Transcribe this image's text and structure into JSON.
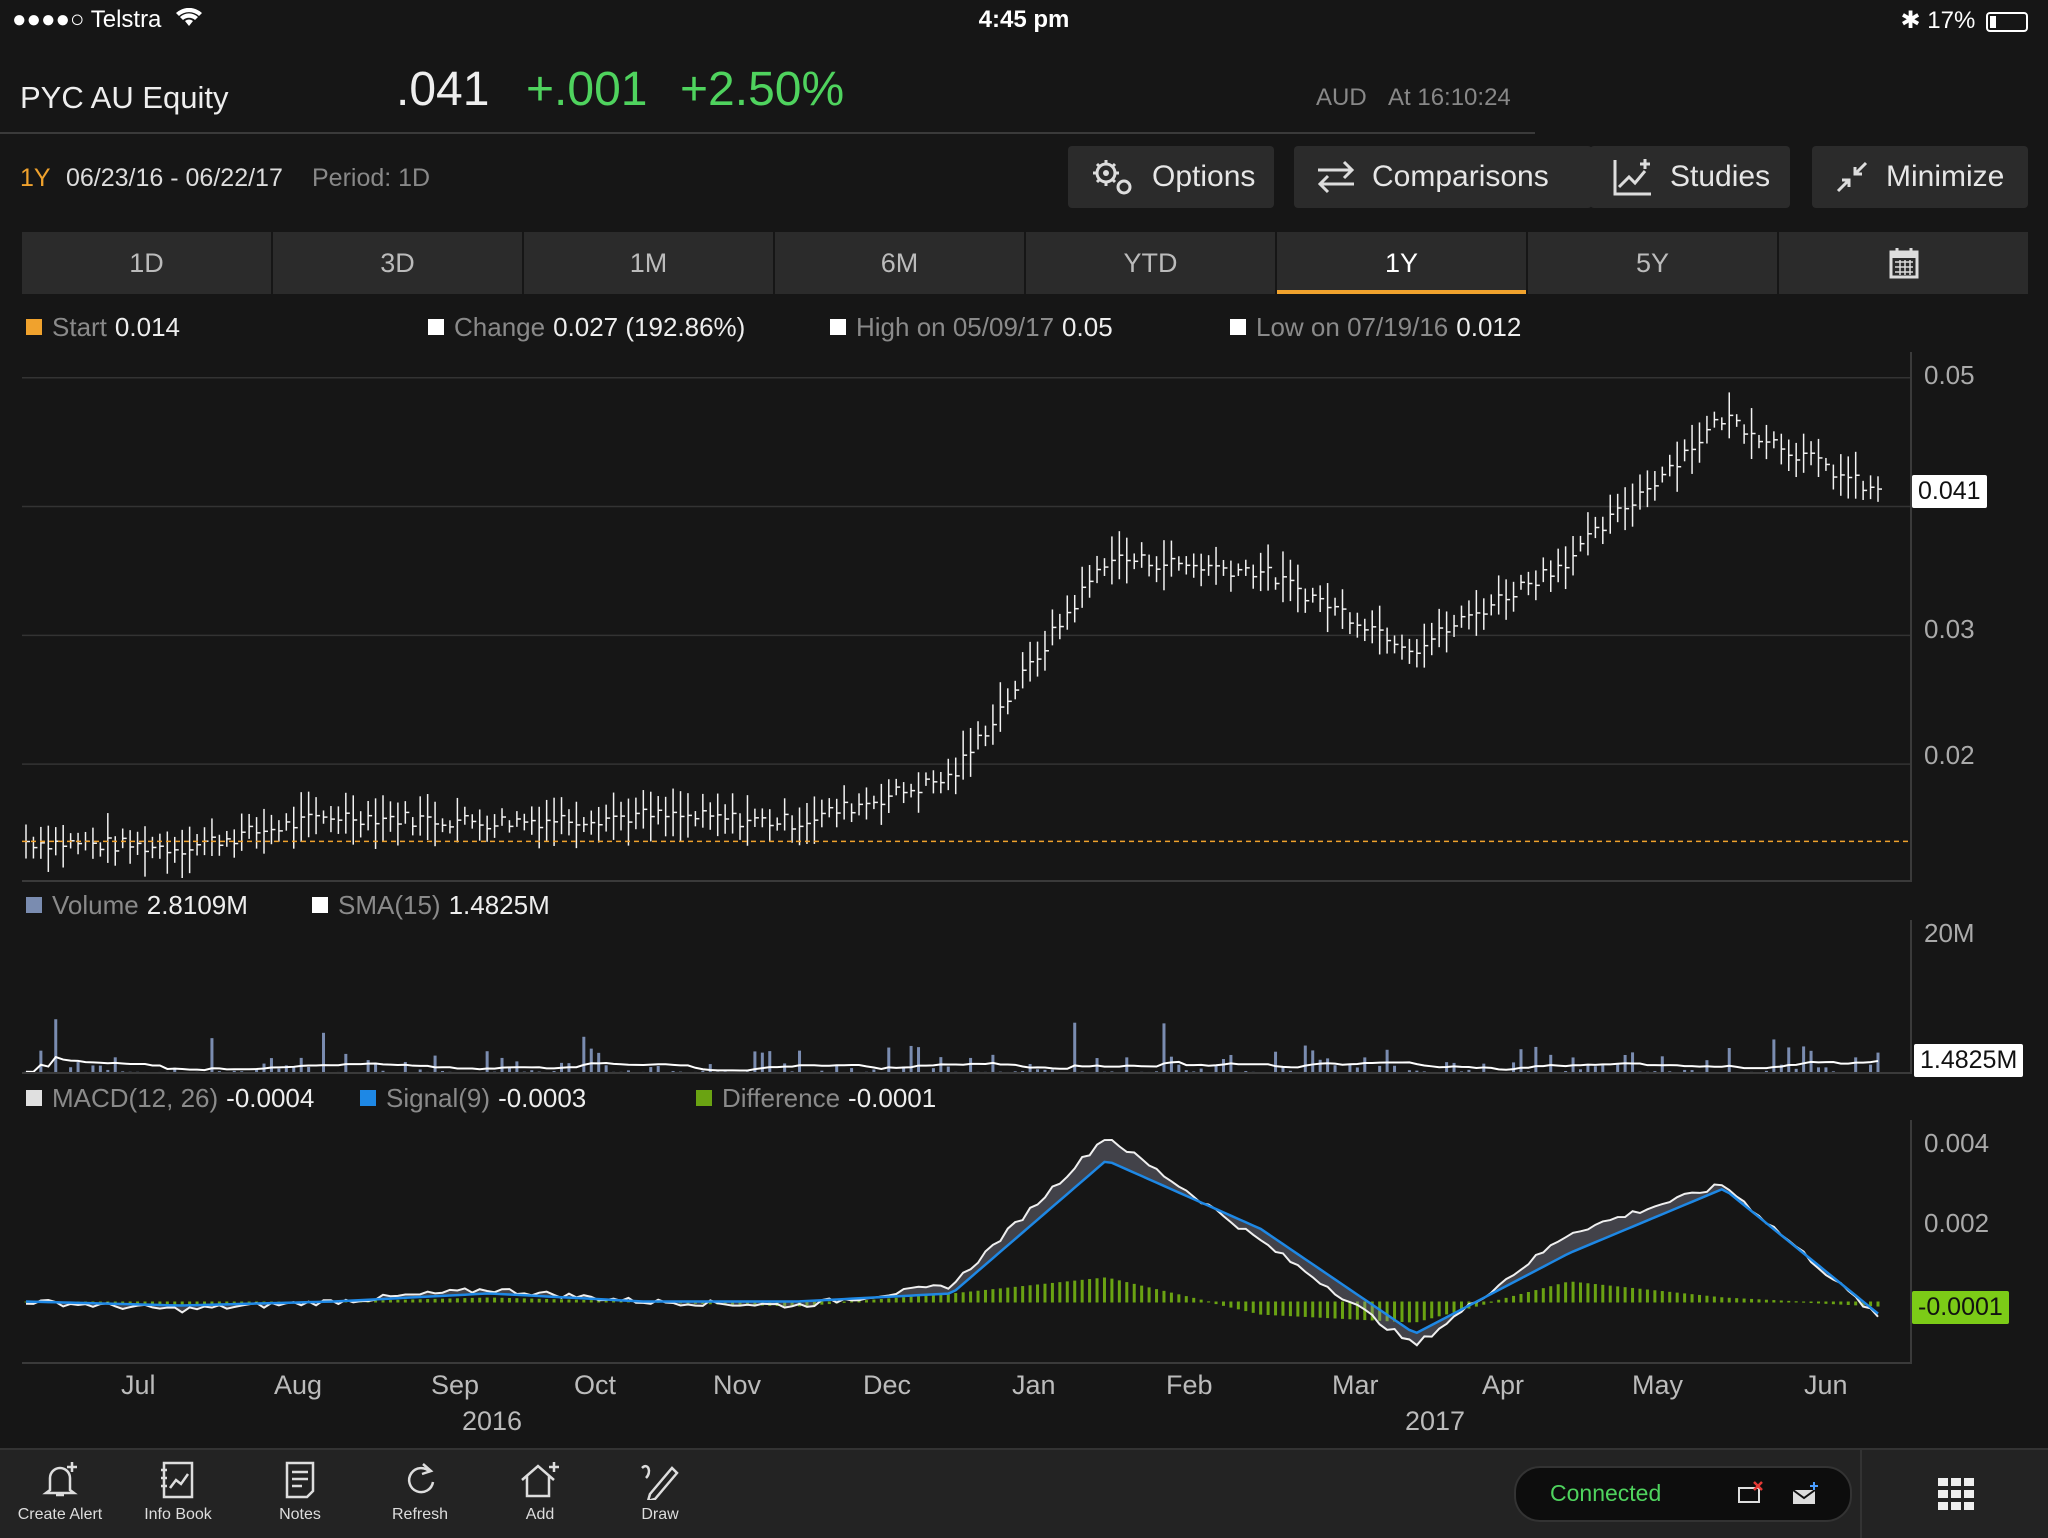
{
  "status_bar": {
    "carrier": "●●●●○ Telstra",
    "time": "4:45 pm",
    "battery": "17%"
  },
  "header": {
    "ticker": "PYC AU Equity",
    "last": ".041",
    "change": "+.001",
    "change_pct": "+2.50%",
    "currency": "AUD",
    "as_of": "At 16:10:24"
  },
  "range": {
    "label": "1Y",
    "dates": "06/23/16 - 06/22/17",
    "period": "Period: 1D"
  },
  "toolbar_buttons": {
    "options": "Options",
    "comparisons": "Comparisons",
    "studies": "Studies",
    "minimize": "Minimize"
  },
  "tabs": [
    "1D",
    "3D",
    "1M",
    "6M",
    "YTD",
    "1Y",
    "5Y"
  ],
  "active_tab": "1Y",
  "price_legend": {
    "start_label": "Start",
    "start_value": "0.014",
    "change_label": "Change",
    "change_value": "0.027 (192.86%)",
    "high_label": "High on 05/09/17",
    "high_value": "0.05",
    "low_label": "Low on 07/19/16",
    "low_value": "0.012"
  },
  "volume_legend": {
    "volume_label": "Volume",
    "volume_value": "2.8109M",
    "sma_label": "SMA(15)",
    "sma_value": "1.4825M"
  },
  "macd_legend": {
    "macd_label": "MACD(12, 26)",
    "macd_value": "-0.0004",
    "signal_label": "Signal(9)",
    "signal_value": "-0.0003",
    "diff_label": "Difference",
    "diff_value": "-0.0001"
  },
  "price_axis": [
    "0.05",
    "0.03",
    "0.02"
  ],
  "price_tag": "0.041",
  "volume_axis": "20M",
  "volume_tag": "1.4825M",
  "macd_axis": [
    "0.004",
    "0.002"
  ],
  "macd_tag": "-0.0001",
  "months": [
    "Jul",
    "Aug",
    "Sep",
    "Oct",
    "Nov",
    "Dec",
    "Jan",
    "Feb",
    "Mar",
    "Apr",
    "May",
    "Jun"
  ],
  "years": [
    "2016",
    "2017"
  ],
  "bottom_tools": [
    "Create Alert",
    "Info Book",
    "Notes",
    "Refresh",
    "Add",
    "Draw"
  ],
  "connection": "Connected",
  "colors": {
    "accent": "#f0a22d",
    "up": "#4fd35e",
    "volume": "#7a8cb0",
    "signal": "#1e88e5",
    "difference": "#6aa312",
    "macd": "#e0e0e0"
  },
  "chart_data": [
    {
      "type": "line",
      "title": "",
      "series": [
        {
          "name": "PYC AU Equity",
          "x": [
            "2016-06",
            "2016-07",
            "2016-08",
            "2016-09",
            "2016-10",
            "2016-11",
            "2016-12",
            "2017-01",
            "2017-02",
            "2017-03",
            "2017-04",
            "2017-05",
            "2017-06"
          ],
          "values": [
            0.014,
            0.0135,
            0.016,
            0.0155,
            0.016,
            0.0155,
            0.019,
            0.036,
            0.035,
            0.029,
            0.036,
            0.047,
            0.041
          ]
        }
      ],
      "ylim": [
        0.011,
        0.052
      ],
      "grid": true
    },
    {
      "type": "bar",
      "series": [
        {
          "name": "Volume",
          "values": [
            2.8109
          ]
        },
        {
          "name": "SMA(15)",
          "values": [
            1.4825
          ]
        }
      ],
      "ylabel": "",
      "ylim": [
        0,
        20
      ]
    },
    {
      "type": "line",
      "series": [
        {
          "name": "MACD(12, 26)",
          "values": [
            0.0,
            -0.0002,
            0.0,
            0.0003,
            0.0,
            -0.0001,
            0.0004,
            0.0041,
            0.0015,
            -0.0011,
            0.0017,
            0.0029,
            -0.0004
          ]
        },
        {
          "name": "Signal(9)",
          "values": [
            0.0,
            -0.0001,
            0.0,
            0.0002,
            0.0,
            0.0,
            0.0002,
            0.0035,
            0.0018,
            -0.0008,
            0.0012,
            0.0028,
            -0.0003
          ]
        },
        {
          "name": "Difference",
          "values": [
            0.0,
            -0.0001,
            0.0,
            0.0001,
            0.0,
            -0.0001,
            0.0002,
            0.0006,
            -0.0003,
            -0.0005,
            0.0005,
            0.0001,
            -0.0001
          ]
        }
      ],
      "ylim": [
        -0.0015,
        0.0045
      ]
    }
  ]
}
